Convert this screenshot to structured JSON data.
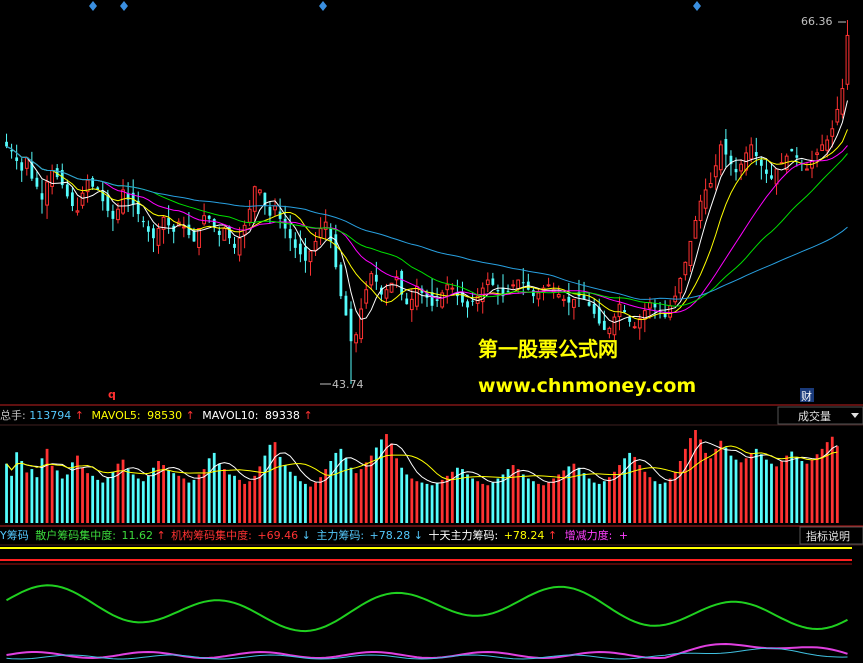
{
  "watermark": {
    "title": "第一股票公式网",
    "url": "www.chnmoney.com"
  },
  "price_panel": {
    "high_label": "66.36",
    "low_label": "43.74",
    "marker_q": "q",
    "marker_cai": "财"
  },
  "volume_panel": {
    "total_label": "总手:",
    "total_value": "113794",
    "mavol5_label": "MAVOL5:",
    "mavol5_value": "98530",
    "mavol10_label": "MAVOL10:",
    "mavol10_value": "89338",
    "arrow_up": "↑",
    "dropdown_label": "成交量"
  },
  "indicator_panel": {
    "name": "Y筹码",
    "retail_label": "散户筹码集中度:",
    "retail_value": "11.62",
    "retail_arrow": "↑",
    "inst_label": "机构筹码集中度:",
    "inst_value": "+69.46",
    "inst_arrow": "↓",
    "main_label": "主力筹码:",
    "main_value": "+78.28",
    "main_arrow": "↓",
    "ten_label": "十天主力筹码:",
    "ten_value": "+78.24",
    "ten_arrow": "↑",
    "change_label": "增减力度:",
    "change_value": "+",
    "explain_button": "指标说明"
  },
  "colors": {
    "up": "#ff3232",
    "down": "#54fcfc",
    "ma_white": "#ffffff",
    "ma_yellow": "#ffff00",
    "ma_magenta": "#ff00ff",
    "ma_green": "#00e000",
    "ma_blue": "#28a0e0",
    "watermark": "#ffff00"
  },
  "chart_data": [
    {
      "type": "candlestick",
      "title": "",
      "ylim": [
        43.74,
        66.36
      ],
      "annotations": [
        "66.36",
        "43.74"
      ],
      "closes": [
        58.5,
        58.2,
        57.6,
        57.0,
        57.8,
        56.5,
        56.0,
        55.2,
        56.3,
        57.0,
        56.6,
        56.1,
        55.4,
        54.8,
        54.5,
        55.6,
        56.4,
        56.0,
        55.8,
        55.1,
        54.5,
        54.0,
        54.6,
        55.8,
        55.2,
        54.9,
        54.3,
        53.8,
        53.2,
        52.8,
        53.4,
        54.1,
        53.6,
        53.2,
        53.8,
        53.5,
        53.0,
        52.6,
        53.4,
        54.2,
        54.0,
        53.5,
        53.0,
        53.4,
        52.8,
        52.2,
        52.8,
        53.6,
        54.6,
        56.0,
        55.8,
        54.8,
        54.2,
        54.8,
        54.0,
        53.4,
        52.8,
        52.2,
        51.8,
        51.4,
        52.0,
        52.6,
        53.4,
        53.8,
        52.6,
        51.0,
        49.2,
        48.0,
        46.4,
        46.8,
        48.4,
        49.6,
        50.6,
        50.1,
        49.3,
        49.6,
        50.0,
        50.4,
        49.3,
        48.7,
        49.0,
        49.8,
        49.4,
        49.1,
        48.6,
        48.9,
        49.4,
        49.9,
        49.7,
        49.2,
        48.8,
        48.5,
        48.9,
        49.2,
        49.7,
        50.2,
        49.9,
        49.5,
        49.2,
        49.5,
        49.9,
        50.2,
        50.0,
        49.6,
        49.2,
        49.4,
        49.7,
        49.9,
        49.6,
        49.3,
        49.0,
        48.8,
        49.0,
        49.2,
        49.0,
        48.6,
        48.1,
        47.5,
        47.1,
        47.2,
        47.9,
        48.7,
        48.2,
        47.6,
        47.3,
        47.8,
        48.3,
        48.8,
        48.5,
        48.2,
        47.9,
        48.6,
        49.2,
        50.3,
        51.3,
        52.6,
        53.9,
        55.1,
        55.8,
        56.2,
        57.3,
        58.6,
        58.0,
        57.4,
        56.9,
        57.4,
        58.1,
        58.6,
        57.9,
        57.3,
        56.8,
        56.5,
        57.1,
        57.5,
        57.9,
        58.2,
        57.8,
        57.4,
        57.1,
        57.6,
        58.1,
        58.6,
        58.9,
        59.6,
        60.8,
        62.1,
        65.4
      ],
      "overlay_series": [
        {
          "name": "",
          "color": "#ffffff",
          "window": 5
        },
        {
          "name": "",
          "color": "#ffff00",
          "window": 10
        },
        {
          "name": "",
          "color": "#ff00ff",
          "window": 20
        },
        {
          "name": "",
          "color": "#00e000",
          "window": 30
        },
        {
          "name": "",
          "color": "#28a0e0",
          "window": 60
        }
      ]
    },
    {
      "type": "bar",
      "title": "",
      "series": [
        {
          "name": "总手",
          "latest": 113794
        },
        {
          "name": "MAVOL5",
          "latest": 98530
        },
        {
          "name": "MAVOL10",
          "latest": 89338
        }
      ],
      "values": [
        88,
        70,
        105,
        92,
        75,
        80,
        68,
        96,
        110,
        85,
        78,
        66,
        72,
        90,
        100,
        82,
        74,
        70,
        64,
        60,
        68,
        76,
        88,
        94,
        80,
        72,
        66,
        62,
        70,
        82,
        92,
        86,
        78,
        74,
        70,
        66,
        60,
        64,
        72,
        80,
        96,
        104,
        88,
        80,
        72,
        70,
        64,
        58,
        62,
        70,
        84,
        100,
        116,
        120,
        98,
        86,
        76,
        70,
        62,
        58,
        54,
        60,
        68,
        80,
        92,
        104,
        110,
        96,
        82,
        74,
        80,
        90,
        100,
        112,
        124,
        132,
        118,
        96,
        82,
        72,
        66,
        62,
        60,
        58,
        56,
        60,
        64,
        70,
        76,
        82,
        80,
        72,
        66,
        62,
        58,
        56,
        60,
        66,
        72,
        80,
        86,
        80,
        72,
        66,
        62,
        58,
        56,
        60,
        66,
        72,
        78,
        84,
        88,
        82,
        74,
        66,
        60,
        58,
        62,
        68,
        76,
        86,
        96,
        104,
        98,
        86,
        76,
        68,
        62,
        58,
        60,
        66,
        76,
        92,
        110,
        126,
        138,
        124,
        104,
        96,
        110,
        122,
        112,
        100,
        94,
        90,
        96,
        104,
        110,
        102,
        94,
        88,
        84,
        92,
        100,
        106,
        98,
        92,
        88,
        94,
        102,
        110,
        120,
        128,
        114
      ]
    },
    {
      "type": "line",
      "title": "",
      "series": [
        {
          "name": "散户筹码集中度",
          "latest": 11.62
        },
        {
          "name": "机构筹码集中度",
          "latest": 69.46
        },
        {
          "name": "主力筹码",
          "latest": 78.28
        },
        {
          "name": "十天主力筹码",
          "latest": 78.24
        },
        {
          "name": "增减力度",
          "latest": null
        }
      ]
    }
  ]
}
